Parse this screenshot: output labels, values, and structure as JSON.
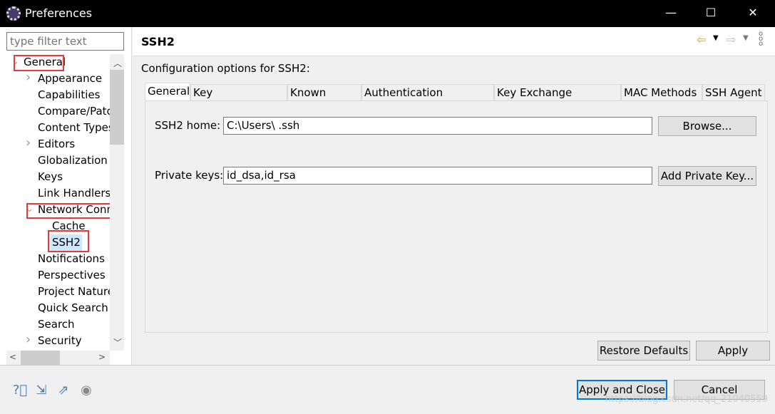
{
  "window": {
    "title": "Preferences",
    "icon": "eclipse-icon"
  },
  "filter": {
    "placeholder": "type filter text"
  },
  "tree": [
    {
      "label": "General",
      "level": 0,
      "expanded": true
    },
    {
      "label": "Appearance",
      "level": 1,
      "collapsed": true
    },
    {
      "label": "Capabilities",
      "level": 1
    },
    {
      "label": "Compare/Patch",
      "level": 1
    },
    {
      "label": "Content Types",
      "level": 1
    },
    {
      "label": "Editors",
      "level": 1,
      "collapsed": true
    },
    {
      "label": "Globalization",
      "level": 1
    },
    {
      "label": "Keys",
      "level": 1
    },
    {
      "label": "Link Handlers",
      "level": 1
    },
    {
      "label": "Network Connections",
      "level": 1,
      "expanded": true
    },
    {
      "label": "Cache",
      "level": 2
    },
    {
      "label": "SSH2",
      "level": 2,
      "selected": true
    },
    {
      "label": "Notifications",
      "level": 1
    },
    {
      "label": "Perspectives",
      "level": 1
    },
    {
      "label": "Project Natures",
      "level": 1
    },
    {
      "label": "Quick Search",
      "level": 1
    },
    {
      "label": "Search",
      "level": 1
    },
    {
      "label": "Security",
      "level": 1,
      "collapsed": true
    }
  ],
  "page": {
    "title": "SSH2",
    "description": "Configuration options for SSH2:"
  },
  "tabs": [
    "General",
    "Key Management",
    "Known Hosts",
    "Authentication Methods",
    "Key Exchange Methods",
    "MAC Methods",
    "SSH Agent"
  ],
  "general": {
    "home_label": "SSH2 home:",
    "home_value": "C:\\Users\\      .ssh",
    "browse": "Browse...",
    "keys_label": "Private keys:",
    "keys_value": "id_dsa,id_rsa",
    "add_key": "Add Private Key..."
  },
  "buttons": {
    "restore": "Restore Defaults",
    "apply": "Apply",
    "apply_close": "Apply and Close",
    "cancel": "Cancel"
  },
  "watermark": "https://blog.csdn.net/qq_21040559",
  "colors": {
    "highlight": "#e8383d",
    "selection": "#cce8ff",
    "default_button": "#0078d7"
  }
}
